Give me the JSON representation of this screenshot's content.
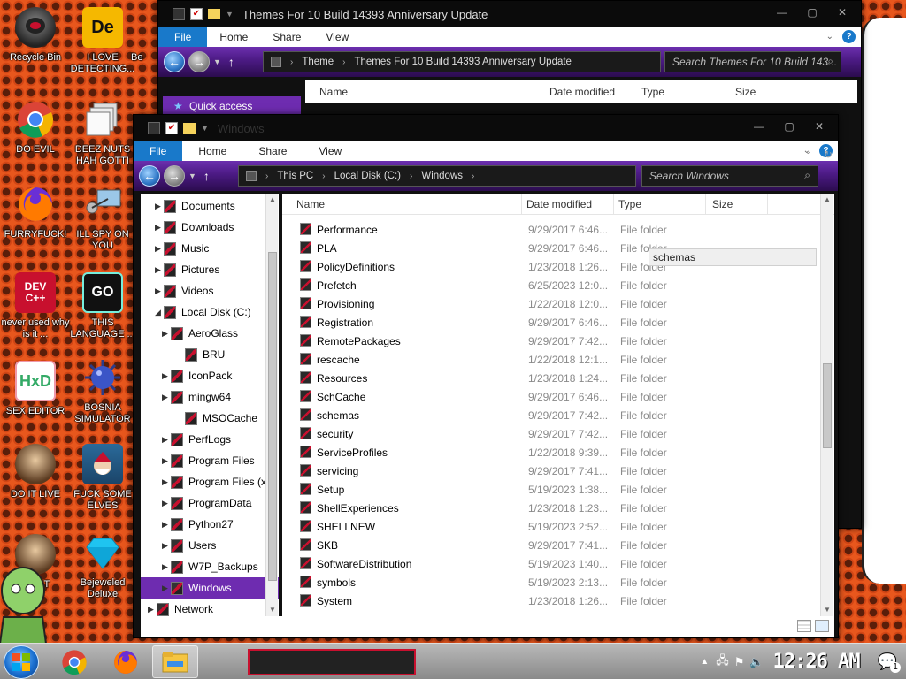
{
  "desktop": {
    "icons": [
      {
        "label": "Recycle Bin"
      },
      {
        "label": "I LOVE DETECTING..."
      },
      {
        "label": "DO EVIL"
      },
      {
        "label": "DEEZ NUTS HAH GOTTI"
      },
      {
        "label": "FURRYFUCK!"
      },
      {
        "label": "ILL SPY ON YOU"
      },
      {
        "label": "never used why is it ..."
      },
      {
        "label": "THIS LANGUAGE ..."
      },
      {
        "label": "SEX EDITOR"
      },
      {
        "label": "BOSNIA SIMULATOR"
      },
      {
        "label": "DO IT LIVE"
      },
      {
        "label": "FUCK SOME ELVES"
      },
      {
        "label": "64 BIT"
      },
      {
        "label": "Bejeweled Deluxe"
      }
    ],
    "partial_icon_label": "Be",
    "icon_glyphs": {
      "detecting": "De",
      "devcpp": "DEV C++",
      "go": "GO",
      "hxd": "HxD"
    }
  },
  "back_window": {
    "title": "Themes For 10 Build 14393 Anniversary Update",
    "ribbon": {
      "file": "File",
      "tabs": [
        "Home",
        "Share",
        "View"
      ]
    },
    "breadcrumb": [
      "Theme",
      "Themes For 10 Build 14393 Anniversary Update"
    ],
    "search_placeholder": "Search Themes For 10 Build 143...",
    "quick_access": "Quick access",
    "columns": [
      "Name",
      "Date modified",
      "Type",
      "Size"
    ]
  },
  "front_window": {
    "title": "Windows",
    "ribbon": {
      "file": "File",
      "tabs": [
        "Home",
        "Share",
        "View"
      ]
    },
    "breadcrumb": [
      "This PC",
      "Local Disk (C:)",
      "Windows"
    ],
    "search_placeholder": "Search Windows",
    "columns": [
      "Name",
      "Date modified",
      "Type",
      "Size"
    ],
    "tree": [
      {
        "label": "Documents",
        "expand": "▶"
      },
      {
        "label": "Downloads",
        "expand": "▶"
      },
      {
        "label": "Music",
        "expand": "▶"
      },
      {
        "label": "Pictures",
        "expand": "▶"
      },
      {
        "label": "Videos",
        "expand": "▶"
      },
      {
        "label": "Local Disk (C:)",
        "expand": "◢"
      },
      {
        "label": "AeroGlass",
        "expand": "▶"
      },
      {
        "label": "BRU",
        "expand": ""
      },
      {
        "label": "IconPack",
        "expand": "▶"
      },
      {
        "label": "mingw64",
        "expand": "▶"
      },
      {
        "label": "MSOCache",
        "expand": ""
      },
      {
        "label": "PerfLogs",
        "expand": "▶"
      },
      {
        "label": "Program Files",
        "expand": "▶"
      },
      {
        "label": "Program Files (x",
        "expand": "▶"
      },
      {
        "label": "ProgramData",
        "expand": "▶"
      },
      {
        "label": "Python27",
        "expand": "▶"
      },
      {
        "label": "Users",
        "expand": "▶"
      },
      {
        "label": "W7P_Backups",
        "expand": "▶"
      },
      {
        "label": "Windows",
        "expand": "▶"
      },
      {
        "label": "Network",
        "expand": "▶"
      }
    ],
    "files": [
      {
        "name": "Performance",
        "date": "9/29/2017 6:46...",
        "type": "File folder"
      },
      {
        "name": "PLA",
        "date": "9/29/2017 6:46...",
        "type": "File folder"
      },
      {
        "name": "PolicyDefinitions",
        "date": "1/23/2018 1:26...",
        "type": "File folder"
      },
      {
        "name": "Prefetch",
        "date": "6/25/2023 12:0...",
        "type": "File folder"
      },
      {
        "name": "Provisioning",
        "date": "1/22/2018 12:0...",
        "type": "File folder"
      },
      {
        "name": "Registration",
        "date": "9/29/2017 6:46...",
        "type": "File folder"
      },
      {
        "name": "RemotePackages",
        "date": "9/29/2017 7:42...",
        "type": "File folder"
      },
      {
        "name": "rescache",
        "date": "1/22/2018 12:1...",
        "type": "File folder"
      },
      {
        "name": "Resources",
        "date": "1/23/2018 1:24...",
        "type": "File folder"
      },
      {
        "name": "SchCache",
        "date": "9/29/2017 6:46...",
        "type": "File folder"
      },
      {
        "name": "schemas",
        "date": "9/29/2017 7:42...",
        "type": "File folder"
      },
      {
        "name": "security",
        "date": "9/29/2017 7:42...",
        "type": "File folder"
      },
      {
        "name": "ServiceProfiles",
        "date": "1/22/2018 9:39...",
        "type": "File folder"
      },
      {
        "name": "servicing",
        "date": "9/29/2017 7:41...",
        "type": "File folder"
      },
      {
        "name": "Setup",
        "date": "5/19/2023 1:38...",
        "type": "File folder"
      },
      {
        "name": "ShellExperiences",
        "date": "1/23/2018 1:23...",
        "type": "File folder"
      },
      {
        "name": "SHELLNEW",
        "date": "5/19/2023 2:52...",
        "type": "File folder"
      },
      {
        "name": "SKB",
        "date": "9/29/2017 7:41...",
        "type": "File folder"
      },
      {
        "name": "SoftwareDistribution",
        "date": "5/19/2023 1:40...",
        "type": "File folder"
      },
      {
        "name": "symbols",
        "date": "5/19/2023 2:13...",
        "type": "File folder"
      },
      {
        "name": "System",
        "date": "1/23/2018 1:26...",
        "type": "File folder"
      }
    ],
    "tooltip": "schemas"
  },
  "taskbar": {
    "clock": "12:26 AM",
    "notification_count": "1"
  },
  "colors": {
    "accent_purple": "#6e2cb0",
    "file_tab_blue": "#1979ca",
    "desktop_orange": "#e8571d"
  }
}
